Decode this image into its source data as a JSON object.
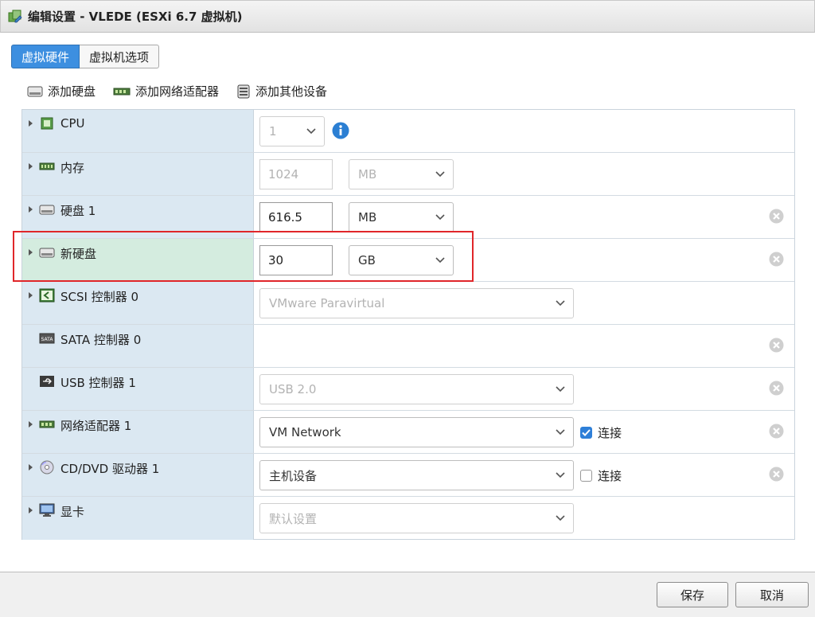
{
  "window": {
    "title": "编辑设置 - VLEDE (ESXi 6.7 虚拟机)"
  },
  "tabs": [
    {
      "label": "虚拟硬件",
      "active": true
    },
    {
      "label": "虚拟机选项",
      "active": false
    }
  ],
  "toolbar": {
    "add_disk": "添加硬盘",
    "add_nic": "添加网络适配器",
    "add_other": "添加其他设备"
  },
  "devices": {
    "cpu": {
      "label": "CPU",
      "value": "1"
    },
    "memory": {
      "label": "内存",
      "value": "1024",
      "unit": "MB"
    },
    "disk1": {
      "label": "硬盘 1",
      "value": "616.5",
      "unit": "MB"
    },
    "new_disk": {
      "label": "新硬盘",
      "value": "30",
      "unit": "GB"
    },
    "scsi": {
      "label": "SCSI 控制器 0",
      "value": "VMware Paravirtual"
    },
    "sata": {
      "label": "SATA 控制器 0"
    },
    "usb": {
      "label": "USB 控制器 1",
      "value": "USB 2.0"
    },
    "nic": {
      "label": "网络适配器 1",
      "value": "VM Network",
      "connect_label": "连接",
      "connected": true
    },
    "cddvd": {
      "label": "CD/DVD 驱动器 1",
      "value": "主机设备",
      "connect_label": "连接",
      "connected": false
    },
    "video": {
      "label": "显卡",
      "value": "默认设置"
    }
  },
  "footer": {
    "save": "保存",
    "cancel": "取消"
  },
  "colors": {
    "accent": "#3d8fe0",
    "label_cell": "#dbe8f2",
    "highlight_cell": "#d4ecdf",
    "highlight_border": "#e0262a"
  }
}
